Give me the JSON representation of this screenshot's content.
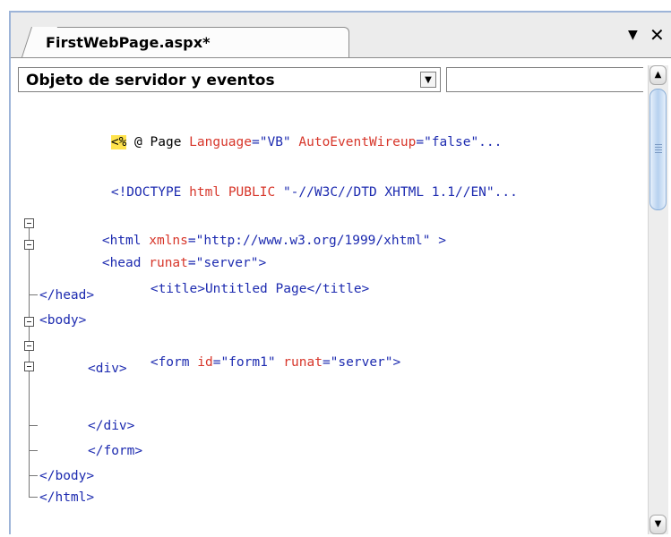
{
  "window": {
    "tab_label": "FirstWebPage.aspx*",
    "menu_icon": "▼",
    "close_icon": "✕"
  },
  "toolbar": {
    "object_combo_value": "Objeto de servidor y eventos",
    "event_combo_value": ""
  },
  "code": {
    "line1": {
      "delim": "<%",
      "rest": " @ Page ",
      "attr1": "Language",
      "eq1": "=",
      "val1": "\"VB\"",
      "sp": " ",
      "attr2": "AutoEventWireup",
      "eq2": "=",
      "val2": "\"false\"..."
    },
    "line2": {
      "open": "<!DOCTYPE ",
      "kw": "html",
      "sp": " ",
      "attr": "PUBLIC",
      "sp2": " ",
      "val": "\"-//W3C//DTD XHTML 1.1//EN\"..."
    },
    "line3": {
      "open": "<html",
      "sp": " ",
      "attr": "xmlns",
      "eq": "=",
      "val": "\"http://www.w3.org/1999/xhtml\"",
      "close": " >"
    },
    "line4": {
      "open": "<head",
      "sp": " ",
      "attr": "runat",
      "eq": "=",
      "val": "\"server\"",
      "close": ">"
    },
    "line5": {
      "open": "<title>",
      "text": "Untitled Page",
      "close": "</title>"
    },
    "line6": {
      "text": "</head>"
    },
    "line7": {
      "text": "<body>"
    },
    "line8": {
      "open": "<form",
      "sp": " ",
      "attr1": "id",
      "eq1": "=",
      "val1": "\"form1\"",
      "sp2": " ",
      "attr2": "runat",
      "eq2": "=",
      "val2": "\"server\"",
      "close": ">"
    },
    "line9": {
      "text": "<div>"
    },
    "line10": {
      "text": "</div>"
    },
    "line11": {
      "text": "</form>"
    },
    "line12": {
      "text": "</body>"
    },
    "line13": {
      "text": "</html>"
    }
  }
}
